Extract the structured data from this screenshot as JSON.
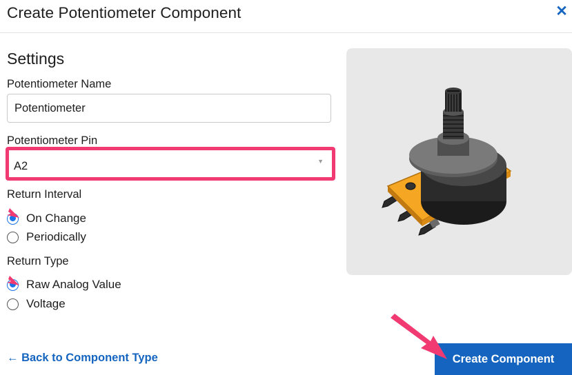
{
  "dialog": {
    "title": "Create Potentiometer Component",
    "close_icon": "close-icon"
  },
  "settings": {
    "heading": "Settings",
    "name_label": "Potentiometer Name",
    "name_value": "Potentiometer",
    "pin_label": "Potentiometer Pin",
    "pin_value": "A2",
    "return_interval": {
      "label": "Return Interval",
      "options": [
        {
          "label": "On Change",
          "checked": true
        },
        {
          "label": "Periodically",
          "checked": false
        }
      ]
    },
    "return_type": {
      "label": "Return Type",
      "options": [
        {
          "label": "Raw Analog Value",
          "checked": true
        },
        {
          "label": "Voltage",
          "checked": false
        }
      ]
    }
  },
  "footer": {
    "back_label": "← Back to Component Type",
    "create_label": "Create Component"
  },
  "colors": {
    "accent": "#1565c0",
    "highlight": "#f23a72",
    "image_bg": "#e8e8e8"
  }
}
